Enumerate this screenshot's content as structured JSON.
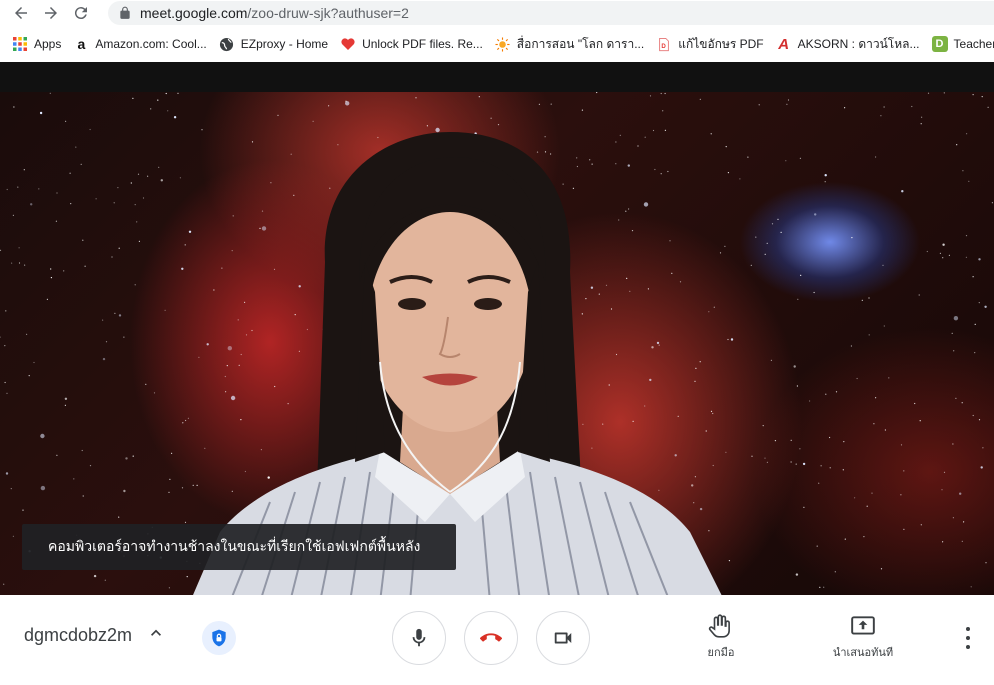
{
  "browser": {
    "url_host": "meet.google.com",
    "url_path": "/zoo-druw-sjk?authuser=2"
  },
  "bookmarks": [
    {
      "label": "Apps",
      "icon": "apps-grid-icon"
    },
    {
      "label": "Amazon.com: Cool...",
      "icon": "amazon-icon"
    },
    {
      "label": "EZproxy - Home",
      "icon": "globe-icon"
    },
    {
      "label": "Unlock PDF files. Re...",
      "icon": "heart-icon"
    },
    {
      "label": "สื่อการสอน \"โลก ดารา...",
      "icon": "sun-icon"
    },
    {
      "label": "แก้ไขอักษร PDF",
      "icon": "document-icon"
    },
    {
      "label": "AKSORN : ดาวน์โหล...",
      "icon": "aksorn-icon"
    },
    {
      "label": "Teacher",
      "icon": "teacher-icon"
    }
  ],
  "video": {
    "notice": "คอมพิวเตอร์อาจทำงานช้าลงในขณะที่เรียกใช้เอฟเฟกต์พื้นหลัง"
  },
  "controls": {
    "meeting_code": "dgmcdobz2m",
    "raise_hand_label": "ยกมือ",
    "present_label": "นำเสนอทันที"
  },
  "colors": {
    "end_call": "#d93025",
    "shield_bg": "#e8f0fe",
    "shield": "#1a73e8"
  }
}
